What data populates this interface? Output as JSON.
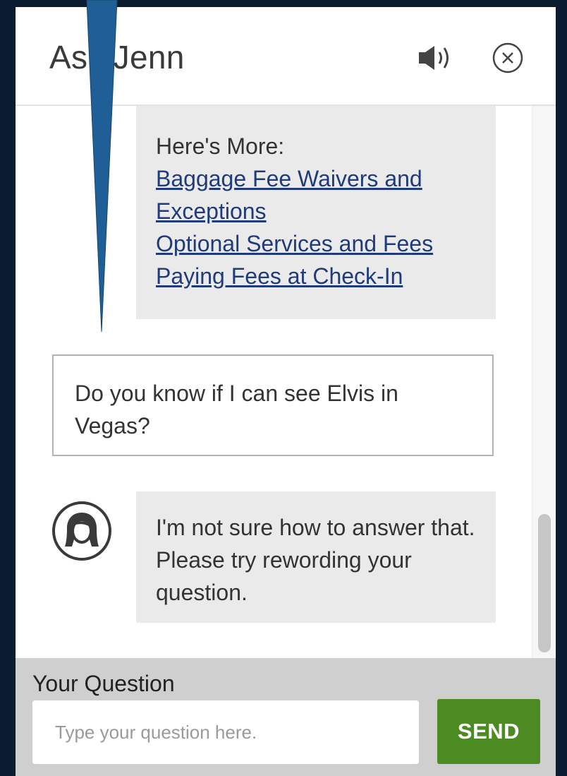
{
  "header": {
    "title": "Ask Jenn",
    "speaker_icon": "speaker-icon",
    "close_icon": "close-circle-icon"
  },
  "messages": [
    {
      "role": "bot",
      "intro": "Here's More:",
      "links": [
        "Baggage Fee Waivers and Exceptions",
        "Optional Services and Fees",
        "Paying Fees at Check-In"
      ]
    },
    {
      "role": "user",
      "text": "Do you know if I can see Elvis in Vegas?"
    },
    {
      "role": "bot",
      "avatar_icon": "agent-avatar-icon",
      "text": "I'm not sure how to answer that. Please try rewording your question."
    }
  ],
  "footer": {
    "label": "Your Question",
    "input_placeholder": "Type your question here.",
    "input_value": "",
    "send_label": "SEND"
  },
  "colors": {
    "frame": "#10263f",
    "pointer": "#1f5e96",
    "bot_bubble": "#eaeaea",
    "link": "#1f3b7a",
    "send_button": "#4c8a22",
    "footer_bg": "#cfcfcf"
  }
}
